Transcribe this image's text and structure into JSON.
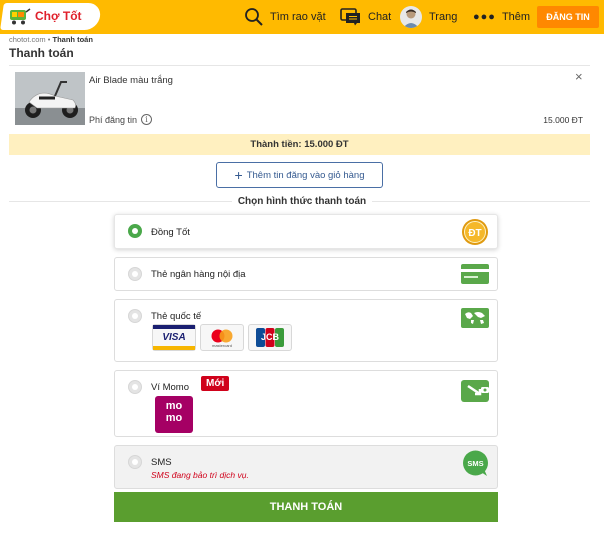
{
  "header": {
    "logo_text": "Chợ Tốt",
    "nav": {
      "search": "Tìm rao vặt",
      "chat": "Chat",
      "user": "Trang",
      "more": "Thêm"
    },
    "post_button": "ĐĂNG TIN",
    "brand_color": "#ffba00",
    "post_color": "#ff8800"
  },
  "breadcrumb": {
    "home": "chotot.com",
    "separator": "•",
    "current": "Thanh toán"
  },
  "page_title": "Thanh toán",
  "cart_item": {
    "name": "Air Blade màu trắng",
    "fee_label": "Phí đăng tin",
    "price": "15.000 ĐT",
    "info_icon": "i",
    "close_icon": "×"
  },
  "total": "Thành tiền: 15.000 ĐT",
  "add_button": {
    "icon": "+",
    "label": "Thêm tin đăng vào giỏ hàng"
  },
  "section_title": "Chọn hình thức thanh toán",
  "payment_options": [
    {
      "label": "Đồng Tốt",
      "selected": true,
      "icon": "dong-tot-coin-icon",
      "icon_text": "ĐT"
    },
    {
      "label": "Thẻ ngân hàng nội địa",
      "selected": false,
      "icon": "bank-card-icon"
    },
    {
      "label": "Thẻ quốc tế",
      "selected": false,
      "icon": "world-card-icon",
      "cards": {
        "visa": "VISA",
        "mastercard": "mastercard",
        "jcb": "JCB"
      }
    },
    {
      "label": "Ví Momo",
      "selected": false,
      "icon": "wallet-icon",
      "badge": "Mới",
      "momo_top": "mo",
      "momo_bottom": "mo"
    },
    {
      "label": "SMS",
      "selected": false,
      "disabled": true,
      "icon": "sms-icon",
      "icon_text": "SMS",
      "note": "SMS đang bảo trì dịch vụ."
    }
  ],
  "pay_button": "THANH TOÁN",
  "colors": {
    "green": "#5a9e2f",
    "selected_radio": "#4aa84a",
    "total_bg": "#fff0c0",
    "warning": "#d0021b",
    "momo": "#a50064"
  }
}
